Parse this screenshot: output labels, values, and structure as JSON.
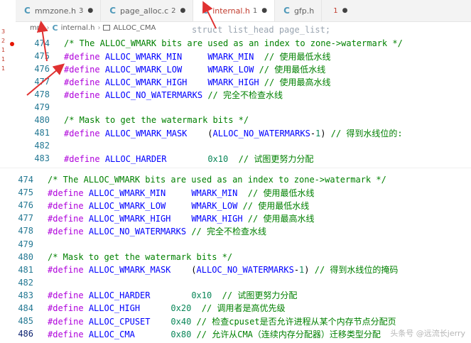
{
  "tabs": [
    {
      "lang": "C",
      "label": "mmzone.h",
      "badge": "3",
      "dot": "●"
    },
    {
      "lang": "C",
      "label": "page_alloc.c",
      "badge": "2",
      "dot": "●"
    },
    {
      "lang": "C",
      "label": "internal.h",
      "badge": "1",
      "dot": "●"
    },
    {
      "lang": "C",
      "label": "gfp.h",
      "badge": "",
      "dot": ""
    },
    {
      "lang": "",
      "label": "",
      "badge": "1",
      "dot": "●"
    }
  ],
  "breadcrumb": {
    "folder": "mm",
    "lang": "C",
    "file": "internal.h",
    "symbol": "ALLOC_CMA"
  },
  "ghost_code": "struct list_head  page_list;",
  "left_gutter": [
    "3",
    "2",
    "1",
    "1",
    "1"
  ],
  "top_lines": [
    {
      "n": "474",
      "hl": false,
      "parts": [
        [
          "cm",
          "/* The ALLOC_WMARK bits are used as an index to zone->watermark */"
        ]
      ]
    },
    {
      "n": "475",
      "parts": [
        [
          "kw",
          "#define"
        ],
        [
          "txt",
          " "
        ],
        [
          "mac",
          "ALLOC_WMARK_MIN"
        ],
        [
          "txt",
          "     "
        ],
        [
          "mac",
          "WMARK_MIN"
        ],
        [
          "cm",
          "  // 使用最低水线"
        ]
      ]
    },
    {
      "n": "476",
      "parts": [
        [
          "kw",
          "#define"
        ],
        [
          "txt",
          " "
        ],
        [
          "mac",
          "ALLOC_WMARK_LOW"
        ],
        [
          "txt",
          "     "
        ],
        [
          "mac",
          "WMARK_LOW"
        ],
        [
          "cm",
          " // 使用最低水线"
        ]
      ]
    },
    {
      "n": "477",
      "parts": [
        [
          "kw",
          "#define"
        ],
        [
          "txt",
          " "
        ],
        [
          "mac",
          "ALLOC_WMARK_HIGH"
        ],
        [
          "txt",
          "    "
        ],
        [
          "mac",
          "WMARK_HIGH"
        ],
        [
          "cm",
          " // 使用最高水线"
        ]
      ]
    },
    {
      "n": "478",
      "parts": [
        [
          "kw",
          "#define"
        ],
        [
          "txt",
          " "
        ],
        [
          "mac",
          "ALLOC_NO_WATERMARKS"
        ],
        [
          "cm",
          " // 完全不检查水线"
        ]
      ]
    },
    {
      "n": "479",
      "parts": []
    },
    {
      "n": "480",
      "parts": [
        [
          "cm",
          "/* Mask to get the watermark bits */"
        ]
      ]
    },
    {
      "n": "481",
      "parts": [
        [
          "kw",
          "#define"
        ],
        [
          "txt",
          " "
        ],
        [
          "mac",
          "ALLOC_WMARK_MASK"
        ],
        [
          "txt",
          "    ("
        ],
        [
          "mac",
          "ALLOC_NO_WATERMARKS"
        ],
        [
          "txt",
          "-"
        ],
        [
          "num",
          "1"
        ],
        [
          "txt",
          ")"
        ],
        [
          "cm",
          " // 得到水线位的:"
        ]
      ]
    },
    {
      "n": "482",
      "parts": []
    },
    {
      "n": "483",
      "parts": [
        [
          "kw",
          "#define"
        ],
        [
          "txt",
          " "
        ],
        [
          "mac",
          "ALLOC_HARDER"
        ],
        [
          "txt",
          "        "
        ],
        [
          "num",
          "0x10"
        ],
        [
          "cm",
          "  // 试图更努力分配"
        ]
      ]
    }
  ],
  "bottom_lines": [
    {
      "n": "474",
      "parts": [
        [
          "cm",
          "/* The ALLOC_WMARK bits are used as an index to zone->watermark */"
        ]
      ]
    },
    {
      "n": "475",
      "parts": [
        [
          "kw",
          "#define"
        ],
        [
          "txt",
          " "
        ],
        [
          "mac",
          "ALLOC_WMARK_MIN"
        ],
        [
          "txt",
          "     "
        ],
        [
          "mac",
          "WMARK_MIN"
        ],
        [
          "cm",
          "  // 使用最低水线"
        ]
      ]
    },
    {
      "n": "476",
      "parts": [
        [
          "kw",
          "#define"
        ],
        [
          "txt",
          " "
        ],
        [
          "mac",
          "ALLOC_WMARK_LOW"
        ],
        [
          "txt",
          "     "
        ],
        [
          "mac",
          "WMARK_LOW"
        ],
        [
          "cm",
          " // 使用最低水线"
        ]
      ]
    },
    {
      "n": "477",
      "parts": [
        [
          "kw",
          "#define"
        ],
        [
          "txt",
          " "
        ],
        [
          "mac",
          "ALLOC_WMARK_HIGH"
        ],
        [
          "txt",
          "    "
        ],
        [
          "mac",
          "WMARK_HIGH"
        ],
        [
          "cm",
          " // 使用最高水线"
        ]
      ]
    },
    {
      "n": "478",
      "parts": [
        [
          "kw",
          "#define"
        ],
        [
          "txt",
          " "
        ],
        [
          "mac",
          "ALLOC_NO_WATERMARKS"
        ],
        [
          "cm",
          " // 完全不检查水线"
        ]
      ]
    },
    {
      "n": "479",
      "parts": []
    },
    {
      "n": "480",
      "parts": [
        [
          "cm",
          "/* Mask to get the watermark bits */"
        ]
      ]
    },
    {
      "n": "481",
      "parts": [
        [
          "kw",
          "#define"
        ],
        [
          "txt",
          " "
        ],
        [
          "mac",
          "ALLOC_WMARK_MASK"
        ],
        [
          "txt",
          "    ("
        ],
        [
          "mac",
          "ALLOC_NO_WATERMARKS"
        ],
        [
          "txt",
          "-"
        ],
        [
          "num",
          "1"
        ],
        [
          "txt",
          ")"
        ],
        [
          "cm",
          " // 得到水线位的掩码"
        ]
      ]
    },
    {
      "n": "482",
      "parts": []
    },
    {
      "n": "483",
      "parts": [
        [
          "kw",
          "#define"
        ],
        [
          "txt",
          " "
        ],
        [
          "mac",
          "ALLOC_HARDER"
        ],
        [
          "txt",
          "        "
        ],
        [
          "num",
          "0x10"
        ],
        [
          "cm",
          "  // 试图更努力分配"
        ]
      ]
    },
    {
      "n": "484",
      "parts": [
        [
          "kw",
          "#define"
        ],
        [
          "txt",
          " "
        ],
        [
          "mac",
          "ALLOC_HIGH"
        ],
        [
          "txt",
          "      "
        ],
        [
          "num",
          "0x20"
        ],
        [
          "cm",
          "  // 调用者是高优先级"
        ]
      ]
    },
    {
      "n": "485",
      "parts": [
        [
          "kw",
          "#define"
        ],
        [
          "txt",
          " "
        ],
        [
          "mac",
          "ALLOC_CPUSET"
        ],
        [
          "txt",
          "    "
        ],
        [
          "num",
          "0x40"
        ],
        [
          "cm",
          " // 检查cpuset是否允许进程从某个内存节点分配页"
        ]
      ]
    },
    {
      "n": "486",
      "cur": true,
      "parts": [
        [
          "kw",
          "#define"
        ],
        [
          "txt",
          " "
        ],
        [
          "mac",
          "ALLOC_CMA"
        ],
        [
          "txt",
          "       "
        ],
        [
          "num",
          "0x80"
        ],
        [
          "cm",
          " // 允许从CMA（连续内存分配器）迁移类型分配"
        ]
      ]
    }
  ],
  "watermark": "头条号 @远流长jerry",
  "colors": {
    "arrow": "#e03131",
    "accent": "#237893"
  }
}
